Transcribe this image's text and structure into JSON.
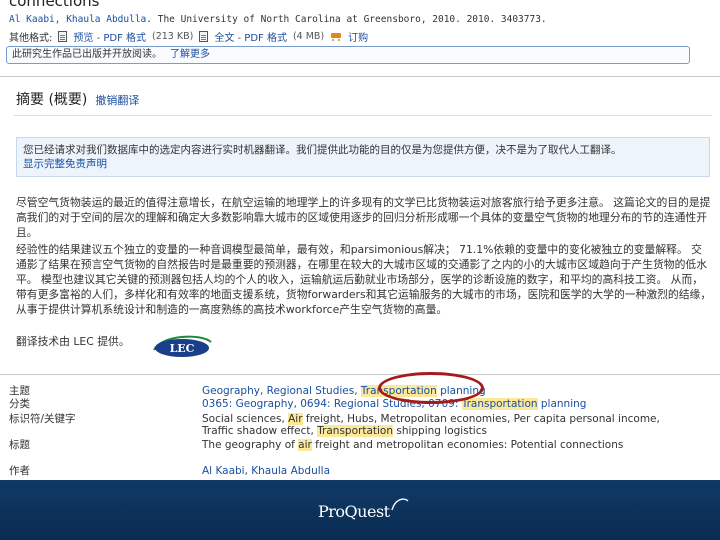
{
  "record": {
    "title": "connections",
    "byline_authors": "Al Kaabi, Khaula Abdulla",
    "byline_rest": ". The University of North Carolina at Greensboro, 2010. 2010. 3403773.",
    "other_formats_label": "其他格式:",
    "preview_label": "预览 - PDF 格式",
    "preview_size": "(213 KB)",
    "fulltext_label": "全文 - PDF 格式",
    "fulltext_size": "(4 MB)",
    "order_label": "订购",
    "open_access_text": "此研究生作品已出版并开放阅读。",
    "learn_more": "了解更多"
  },
  "abstract": {
    "heading": "摘要 (概要)",
    "cancel_translation": "撤销翻译",
    "notice_text": "您已经请求对我们数据库中的选定内容进行实时机器翻译。我们提供此功能的目的仅是为您提供方便，决不是为了取代人工翻译。",
    "notice_link": "显示完整免责声明",
    "para1": "尽管空气货物装运的最近的值得注意增长，在航空运输的地理学上的许多现有的文学已比货物装运对旅客旅行给予更多注意。 这篇论文的目的是提高我们的对于空间的层次的理解和确定大多数影响靠大城市的区域使用逐步的回归分析形成哪一个具体的变量空气货物的地理分布的节的连通性开且。",
    "para2": "经验性的结果建议五个独立的变量的一种音调模型最简单，最有效，和parsimonious解决； 71.1%依赖的变量中的变化被独立的变量解释。 交通影了结果在预言空气货物的自然报告时是最重要的预测器，在哪里在较大的大城市区域的交通影了之内的小的大城市区域趋向于产生货物的低水平。 模型也建议其它关键的预测器包括人均的个人的收入，运输航运后勤就业市场部分，医学的诊断设施的数字，和平均的高科技工资。 从而，带有更多富裕的人们，多样化和有效率的地面支援系统，货物forwarders和其它运输服务的大城市的市场，医院和医学的大学的一种激烈的结缘，从事于提供计算机系统设计和制造的一高度熟练的高技术workforce产生空气货物的高量。",
    "credit": "翻译技术由 LEC 提供。",
    "lec_logo_text": "LEC"
  },
  "details": {
    "subject_label": "主题",
    "subject_pre": "Geography, Regional Studies, ",
    "subject_hl": "Transportation",
    "subject_post": " planning",
    "class_label": "分类",
    "class_pre": "0365: Geography, 0694: Regional Studies, 0709: ",
    "class_hl": "Transportation",
    "class_post": " planning",
    "keyword_label": "标识符/关键字",
    "kw_pre": "Social sciences, ",
    "kw_hl1": "Air",
    "kw_mid": " freight, Hubs, Metropolitan economies, Per capita personal income, Traffic shadow effect, ",
    "kw_hl2": "Transportation",
    "kw_post": " shipping logistics",
    "title_label": "标题",
    "title_pre": "The geography of ",
    "title_hl": "air",
    "title_post": " freight and metropolitan economies: Potential connections",
    "author_label": "作者",
    "author_value": "Al Kaabi, Khaula Abdulla"
  },
  "footer": {
    "brand": "ProQuest"
  },
  "colors": {
    "link": "#1a4fa0",
    "highlight": "#fbe89a",
    "annotation_circle": "#a51a1a",
    "footer_bg": "#0f3a66"
  }
}
